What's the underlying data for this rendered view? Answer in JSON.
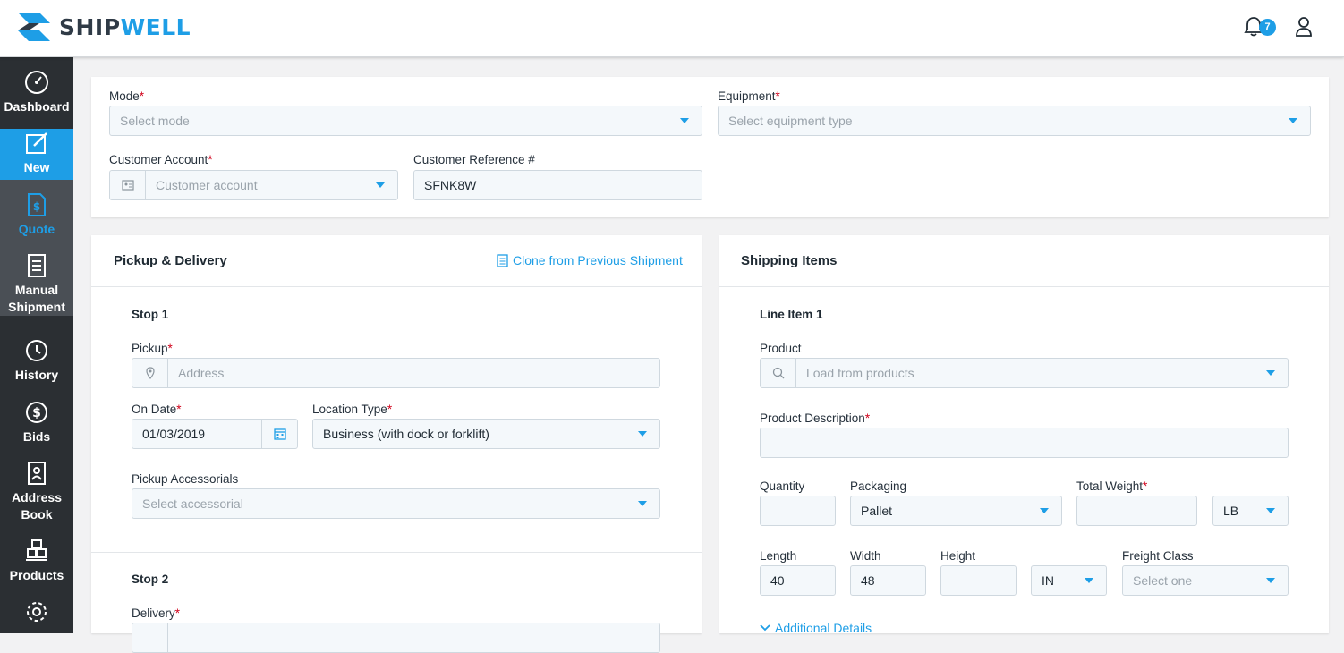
{
  "brand": {
    "name_part1": "SHIP",
    "name_part2": "WELL"
  },
  "header": {
    "notification_count": "7"
  },
  "sidebar": {
    "items": [
      {
        "label": "Dashboard"
      },
      {
        "label": "New"
      },
      {
        "label": "Quote"
      },
      {
        "label_line1": "Manual",
        "label_line2": "Shipment"
      },
      {
        "label": "History"
      },
      {
        "label": "Bids"
      },
      {
        "label_line1": "Address",
        "label_line2": "Book"
      },
      {
        "label": "Products"
      }
    ]
  },
  "top_form": {
    "mode": {
      "label": "Mode",
      "placeholder": "Select mode"
    },
    "equipment": {
      "label": "Equipment",
      "placeholder": "Select equipment type"
    },
    "customer_account": {
      "label": "Customer Account",
      "placeholder": "Customer account"
    },
    "customer_reference": {
      "label": "Customer Reference #",
      "value": "SFNK8W"
    }
  },
  "pickup_delivery": {
    "title": "Pickup & Delivery",
    "clone_link": "Clone from Previous Shipment",
    "stop1": {
      "title": "Stop 1",
      "pickup_label": "Pickup",
      "address_placeholder": "Address",
      "on_date_label": "On Date",
      "on_date_value": "01/03/2019",
      "location_type_label": "Location Type",
      "location_type_value": "Business (with dock or forklift)",
      "accessorials_label": "Pickup Accessorials",
      "accessorials_placeholder": "Select accessorial"
    },
    "stop2": {
      "title": "Stop 2",
      "delivery_label": "Delivery"
    }
  },
  "shipping_items": {
    "title": "Shipping Items",
    "line_item_title": "Line Item 1",
    "product_label": "Product",
    "product_placeholder": "Load from products",
    "description_label": "Product Description",
    "quantity_label": "Quantity",
    "packaging_label": "Packaging",
    "packaging_value": "Pallet",
    "total_weight_label": "Total Weight",
    "weight_unit": "LB",
    "length_label": "Length",
    "length_value": "40",
    "width_label": "Width",
    "width_value": "48",
    "height_label": "Height",
    "dim_unit": "IN",
    "freight_class_label": "Freight Class",
    "freight_class_placeholder": "Select one",
    "additional_details": "Additional Details"
  }
}
